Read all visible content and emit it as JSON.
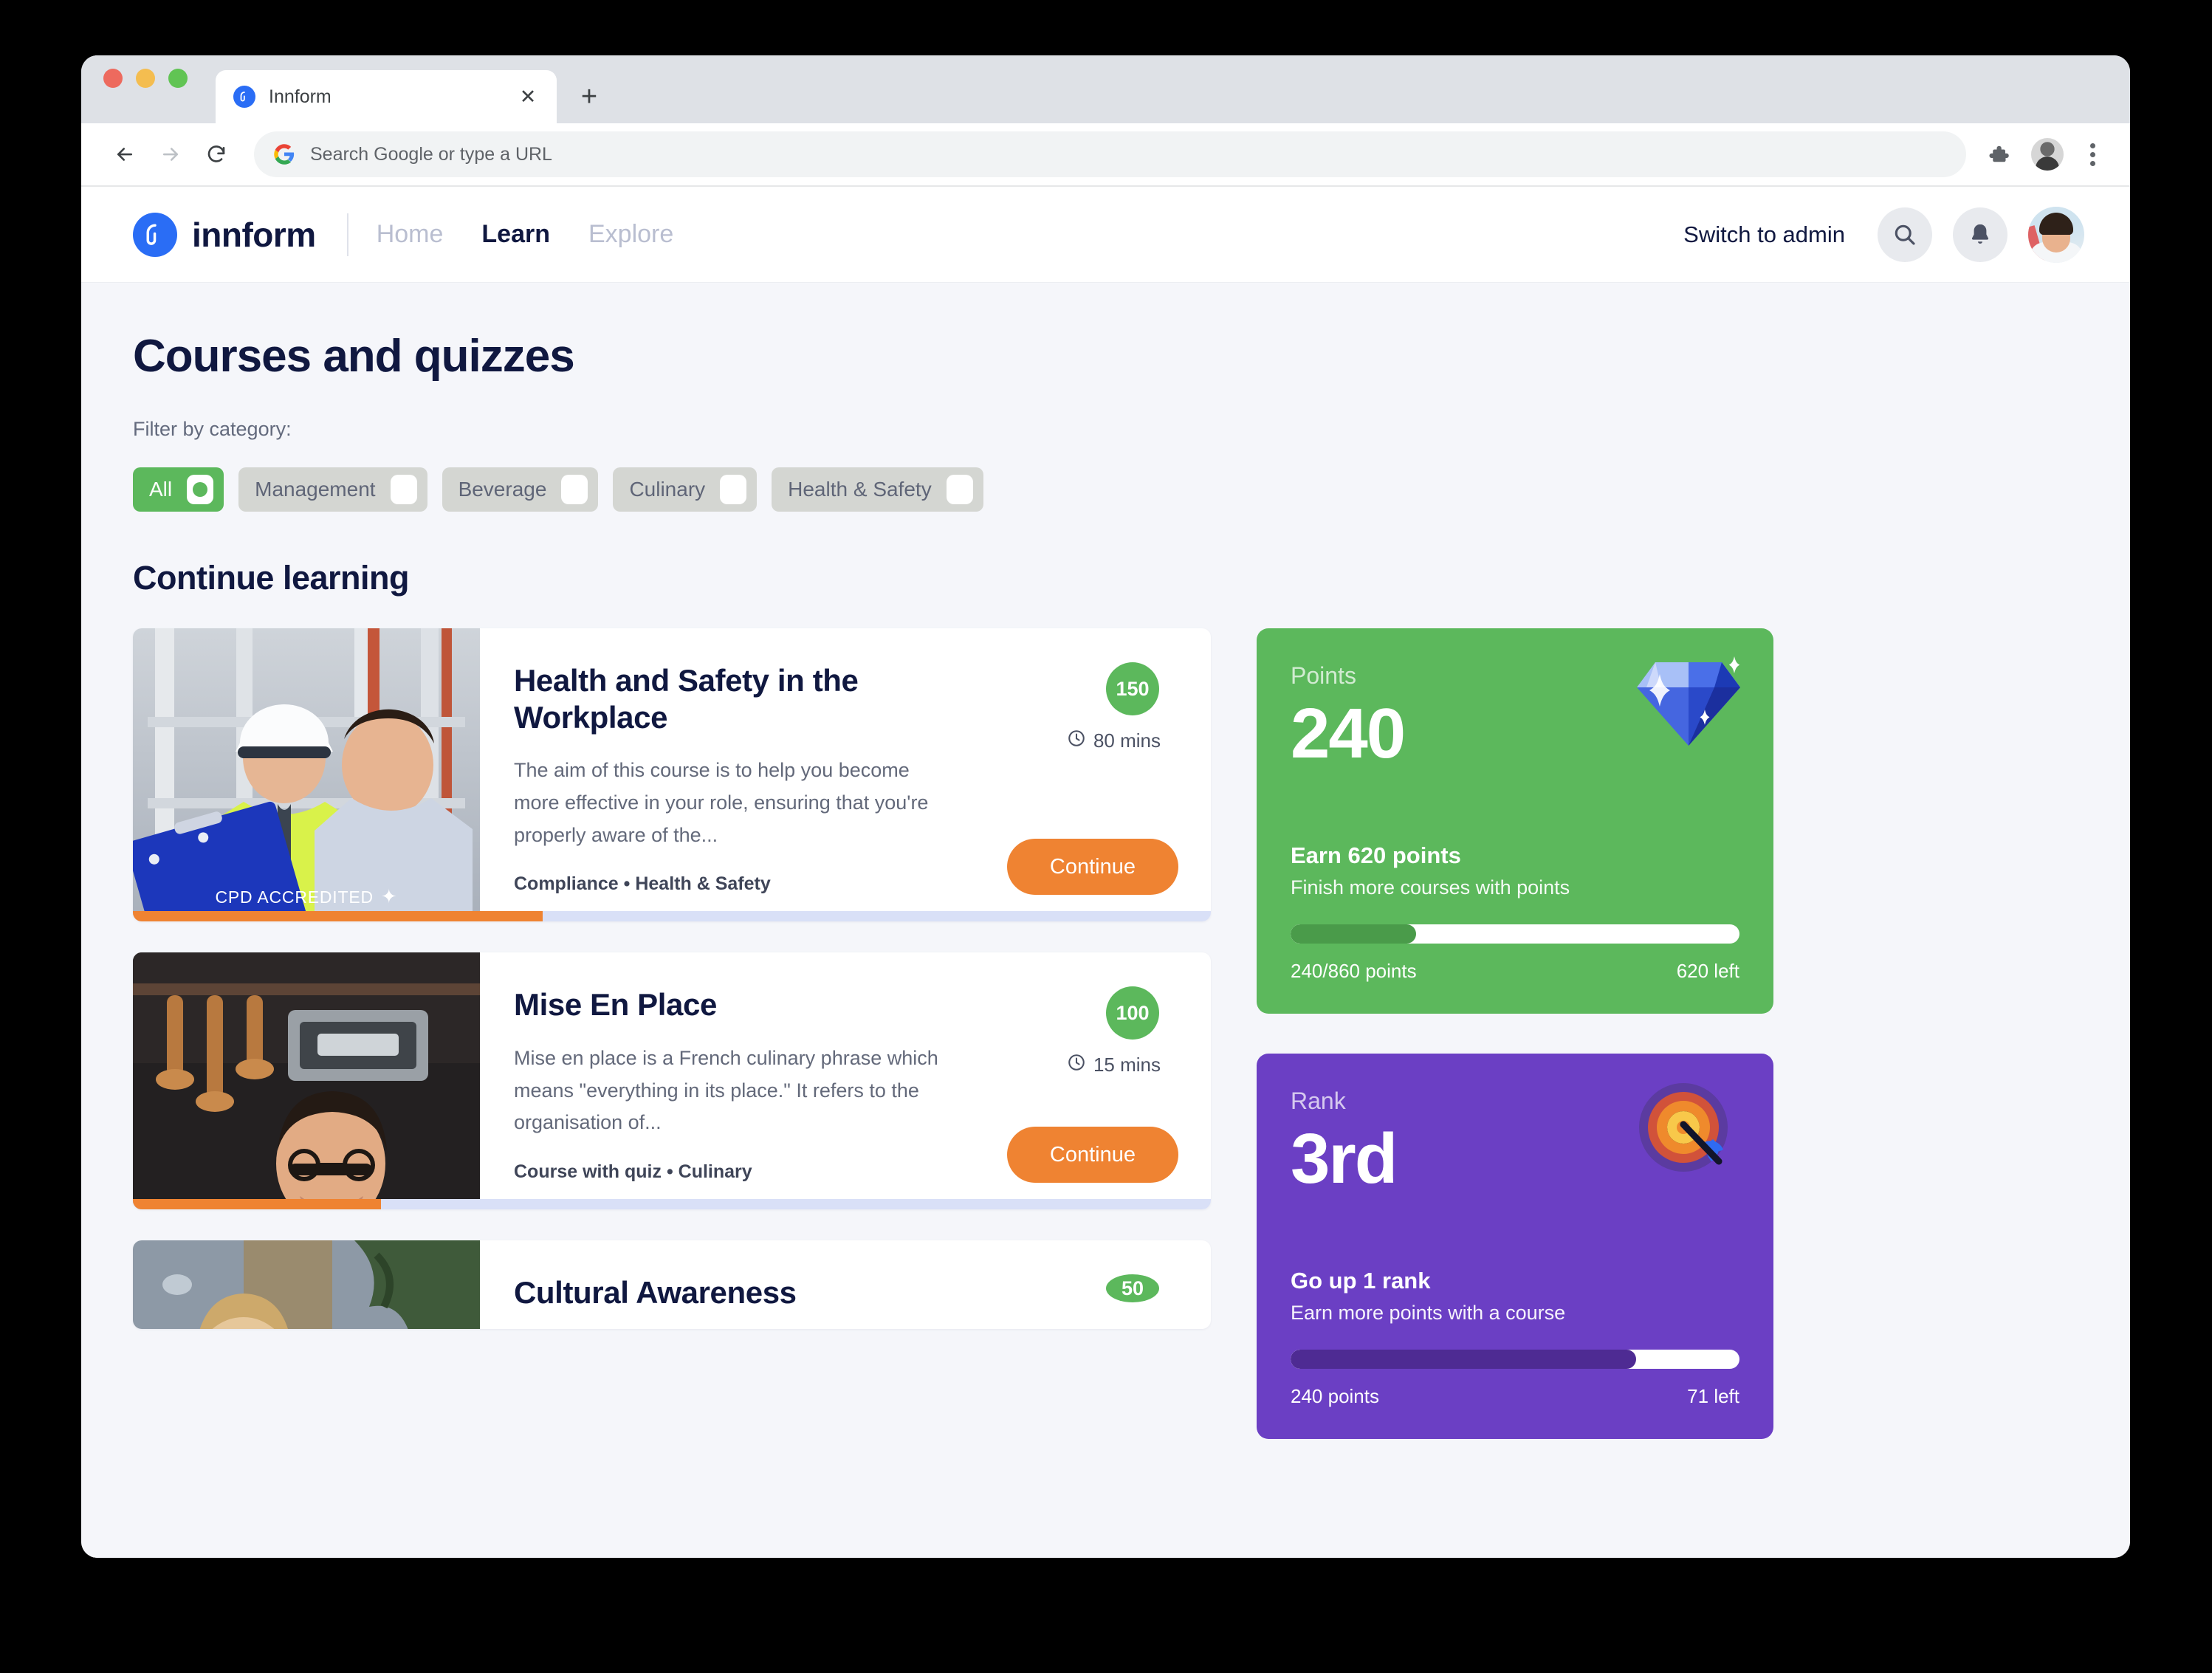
{
  "browser": {
    "tab": {
      "title": "Innform",
      "favicon_icon": "innform-logo-icon",
      "close_icon": "close-icon"
    },
    "new_tab_label": "+",
    "back_icon": "arrow-back-icon",
    "forward_icon": "arrow-forward-icon",
    "reload_icon": "reload-icon",
    "omnibox": {
      "placeholder": "Search Google or type a URL",
      "value": "Search Google or type a URL",
      "search_engine_icon": "google-icon"
    },
    "extensions_icon": "puzzle-piece-icon",
    "profile_icon": "browser-profile-avatar",
    "menu_icon": "kebab-menu-icon"
  },
  "app_header": {
    "brand_name": "innform",
    "brand_icon": "innform-logo-icon",
    "nav": [
      {
        "label": "Home",
        "active": false
      },
      {
        "label": "Learn",
        "active": true
      },
      {
        "label": "Explore",
        "active": false
      }
    ],
    "switch_to_admin": "Switch to admin",
    "search_icon": "search-icon",
    "notifications_icon": "bell-icon",
    "avatar_icon": "user-avatar"
  },
  "page": {
    "title": "Courses and quizzes",
    "filter_label": "Filter by category:",
    "filters": [
      {
        "label": "All",
        "selected": true
      },
      {
        "label": "Management",
        "selected": false
      },
      {
        "label": "Beverage",
        "selected": false
      },
      {
        "label": "Culinary",
        "selected": false
      },
      {
        "label": "Health & Safety",
        "selected": false
      }
    ],
    "section_title": "Continue learning"
  },
  "courses": [
    {
      "title": "Health and Safety in the Workplace",
      "description": "The aim of this course is to help you become more effective in your role, ensuring that you're properly aware of the...",
      "meta": "Compliance • Health & Safety",
      "points": "150",
      "duration": "80 mins",
      "button": "Continue",
      "progress_pct": 38,
      "badge_text": "CPD ACCREDITED",
      "badge_icon": "sparkle-seal-icon",
      "clock_icon": "clock-icon"
    },
    {
      "title": "Mise En Place",
      "description": "Mise en place is a French culinary phrase which means \"everything in its place.\" It refers to the organisation of...",
      "meta": "Course with quiz • Culinary",
      "points": "100",
      "duration": "15 mins",
      "button": "Continue",
      "progress_pct": 23,
      "clock_icon": "clock-icon"
    },
    {
      "title": "Cultural Awareness",
      "points": "50"
    }
  ],
  "stats": [
    {
      "label": "Points",
      "value": "240",
      "emoji_icon": "gem-diamond-icon",
      "cta": "Earn 620 points",
      "sub": "Finish more courses with points",
      "progress_pct": 28,
      "foot_left": "240/860 points",
      "foot_right": "620 left",
      "color": "#5cb85c"
    },
    {
      "label": "Rank",
      "value": "3rd",
      "emoji_icon": "dart-target-icon",
      "cta": "Go up 1 rank",
      "sub": "Earn more points with a course",
      "progress_pct": 77,
      "foot_left": "240 points",
      "foot_right": "71 left",
      "color": "#6b3fc4"
    }
  ],
  "colors": {
    "accent_orange": "#ef8332",
    "green": "#5cb85c",
    "purple": "#6b3fc4",
    "navy": "#101840",
    "brand_blue": "#2a6df5"
  }
}
